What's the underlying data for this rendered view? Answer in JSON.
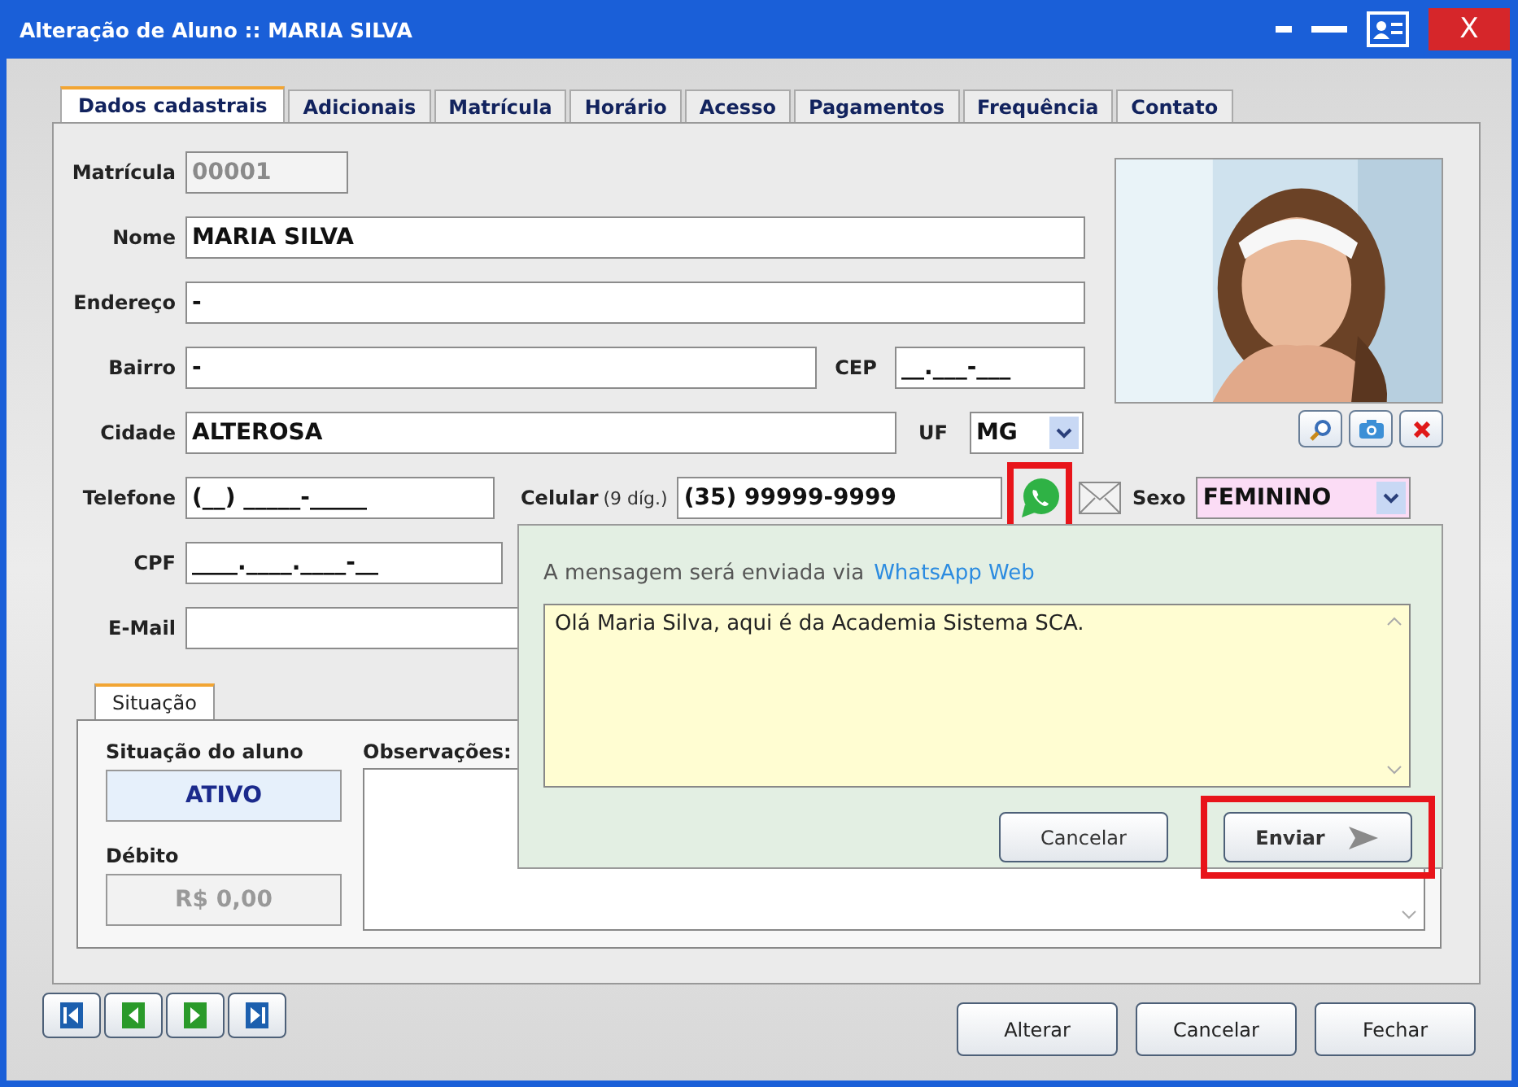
{
  "window": {
    "title": "Alteração de Aluno :: MARIA SILVA",
    "close_label": "X"
  },
  "tabs": [
    {
      "label": "Dados cadastrais",
      "selected": true
    },
    {
      "label": "Adicionais",
      "selected": false
    },
    {
      "label": "Matrícula",
      "selected": false
    },
    {
      "label": "Horário",
      "selected": false
    },
    {
      "label": "Acesso",
      "selected": false
    },
    {
      "label": "Pagamentos",
      "selected": false
    },
    {
      "label": "Frequência",
      "selected": false
    },
    {
      "label": "Contato",
      "selected": false
    }
  ],
  "form": {
    "matricula": {
      "label": "Matrícula",
      "value": "00001",
      "disabled": true
    },
    "nome": {
      "label": "Nome",
      "value": "MARIA SILVA"
    },
    "endereco": {
      "label": "Endereço",
      "value": "-"
    },
    "bairro": {
      "label": "Bairro",
      "value": "-"
    },
    "cep": {
      "label": "CEP",
      "value": "__.___-___"
    },
    "cidade": {
      "label": "Cidade",
      "value": "ALTEROSA"
    },
    "uf": {
      "label": "UF",
      "value": "MG"
    },
    "telefone": {
      "label": "Telefone",
      "value": "(__) _____-_____"
    },
    "celular": {
      "label": "Celular",
      "hint": "(9 díg.)",
      "value": "(35) 99999-9999",
      "whatsapp_highlighted": true
    },
    "sexo": {
      "label": "Sexo",
      "value": "FEMININO"
    },
    "cpf": {
      "label": "CPF",
      "value": "____.____.____-__"
    },
    "email": {
      "label": "E-Mail"
    }
  },
  "status_panel": {
    "tab": "Situação",
    "status_label": "Situação do aluno",
    "status": "ATIVO",
    "debt_label": "Débito",
    "debt": "R$ 0,00",
    "notes_label": "Observações:"
  },
  "whatsapp_popup": {
    "intro": "A mensagem será enviada via",
    "link": "WhatsApp Web",
    "message": "Olá Maria Silva, aqui é da Academia Sistema SCA.",
    "buttons": [
      {
        "kind": "cancel",
        "label": "Cancelar",
        "highlighted": false
      },
      {
        "kind": "send",
        "label": "Enviar",
        "highlighted": true
      }
    ]
  },
  "footer_buttons": [
    "Alterar",
    "Cancelar",
    "Fechar"
  ]
}
